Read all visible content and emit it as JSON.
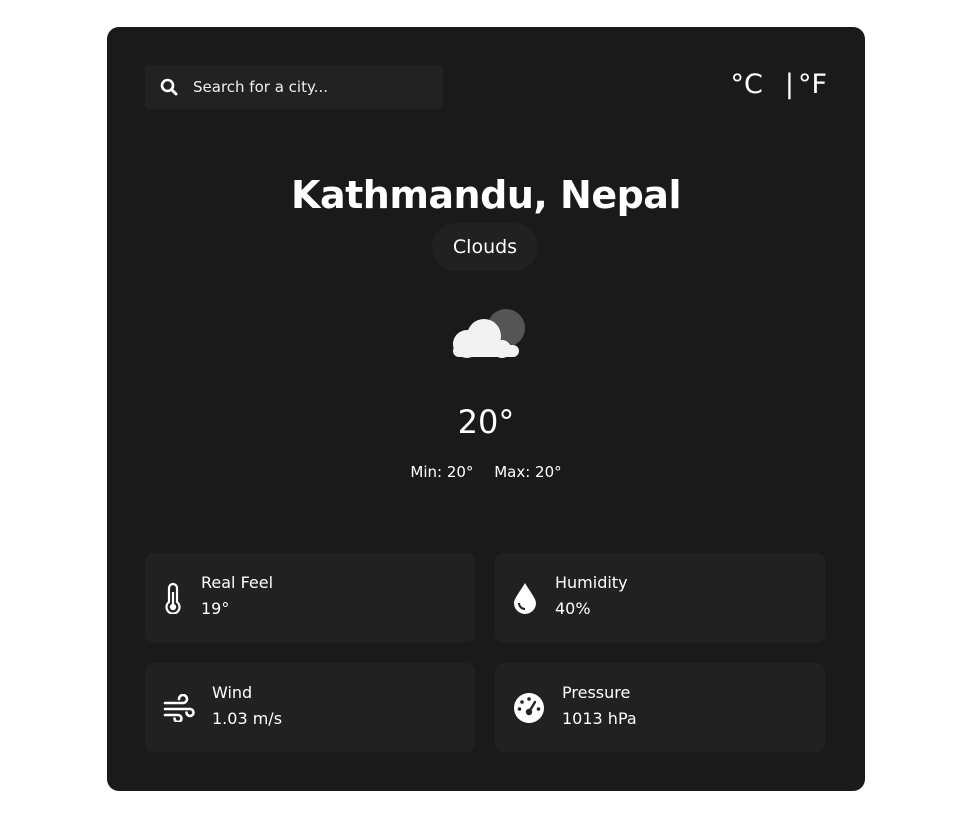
{
  "search": {
    "placeholder": "Search for a city...",
    "icon": "search-icon"
  },
  "units": {
    "celsius": "°C",
    "separator": "|",
    "fahrenheit": "°F"
  },
  "location": {
    "city": "Kathmandu, Nepal",
    "condition": "Clouds",
    "condition_icon": "cloud-moon-icon"
  },
  "temperature": {
    "current": "20°",
    "min": "Min: 20°",
    "max": "Max: 20°"
  },
  "details": [
    {
      "label": "Real Feel",
      "value": "19°",
      "icon": "thermometer-icon"
    },
    {
      "label": "Humidity",
      "value": "40%",
      "icon": "droplet-icon"
    },
    {
      "label": "Wind",
      "value": "1.03 m/s",
      "icon": "wind-icon"
    },
    {
      "label": "Pressure",
      "value": "1013 hPa",
      "icon": "gauge-icon"
    }
  ],
  "colors": {
    "card_bg": "#1a1a1a",
    "tile_bg": "#212121",
    "text": "#ffffff"
  }
}
